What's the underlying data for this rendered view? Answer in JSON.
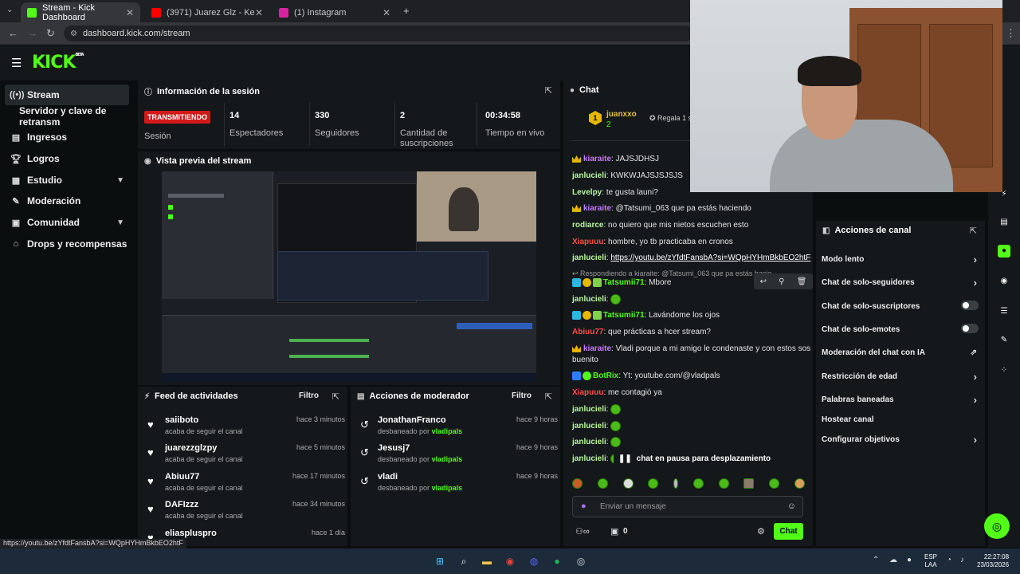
{
  "browser": {
    "tabs": [
      {
        "label": "Stream - Kick Dashboard",
        "active": true
      },
      {
        "label": "(3971) Juarez Glz - Kendo (Visu",
        "active": false
      },
      {
        "label": "(1) Instagram",
        "active": false
      }
    ],
    "url": "dashboard.kick.com/stream",
    "status_url": "https://youtu.be/zYfdtFansbA?si=WQpHYHmBkbEO2htF"
  },
  "brand": {
    "logo": "KICK",
    "beta": "BETA"
  },
  "sidebar": {
    "items": [
      {
        "label": "Stream",
        "icon": "broadcast-icon"
      },
      {
        "label": "Servidor y clave de retransm",
        "icon": ""
      },
      {
        "label": "Ingresos",
        "icon": "chart-icon"
      },
      {
        "label": "Logros",
        "icon": "trophy-icon"
      },
      {
        "label": "Estudio",
        "icon": "studio-icon"
      },
      {
        "label": "Moderación",
        "icon": "wrench-icon"
      },
      {
        "label": "Comunidad",
        "icon": "community-icon"
      },
      {
        "label": "Drops y recompensas",
        "icon": "gift-icon"
      }
    ]
  },
  "session": {
    "title": "Información de la sesión",
    "live_badge": "TRANSMITIENDO",
    "live_label": "Sesión",
    "stats": [
      {
        "value": "14",
        "label": "Espectadores"
      },
      {
        "value": "330",
        "label": "Seguidores"
      },
      {
        "value": "2",
        "label": "Cantidad de suscripciones"
      },
      {
        "value": "00:34:58",
        "label": "Tiempo en vivo"
      }
    ]
  },
  "preview": {
    "title": "Vista previa del stream"
  },
  "activity": {
    "title": "Feed de actividades",
    "filter": "Filtro",
    "items": [
      {
        "name": "saiiboto",
        "sub": "acaba de seguir el canal",
        "time": "hace 3 minutos"
      },
      {
        "name": "juarezzglzpy",
        "sub": "acaba de seguir el canal",
        "time": "hace 5 minutos"
      },
      {
        "name": "Abiuu77",
        "sub": "acaba de seguir el canal",
        "time": "hace 17 minutos"
      },
      {
        "name": "DAFIzzz",
        "sub": "acaba de seguir el canal",
        "time": "hace 34 minutos"
      },
      {
        "name": "eliaspluspro",
        "sub": "",
        "time": "hace 1 día"
      }
    ]
  },
  "modactions": {
    "title": "Acciones de moderador",
    "filter": "Filtro",
    "prefix": "desbaneado por",
    "items": [
      {
        "name": "JonathanFranco",
        "by": "vladipals",
        "time": "hace 9 horas"
      },
      {
        "name": "Jesusj7",
        "by": "vladipals",
        "time": "hace 9 horas"
      },
      {
        "name": "vladi",
        "by": "vladipals",
        "time": "hace 9 horas"
      }
    ]
  },
  "chat": {
    "title": "Chat",
    "pinned": {
      "rank": "1",
      "user": "juanxxo",
      "count": "2",
      "gift": "Regala 1 sus"
    },
    "reply_to": "Respondiendo a kiaraite: @Tatsumi_063 que pa estás hacie",
    "messages": [
      {
        "user": "kiaraite",
        "text": "JAJSJDHSJ",
        "color": "#c57bff"
      },
      {
        "user": "janlucieli",
        "text": "KWKWJAJSJSJSJS",
        "color": "#b9f6a0"
      },
      {
        "user": "Levelpy",
        "text": "te gusta launi?",
        "color": "#b9f6a0"
      },
      {
        "user": "kiaraite",
        "text": "@Tatsumi_063 que pa estás haciendo",
        "color": "#c57bff"
      },
      {
        "user": "rodiarce",
        "text": "no quiero que mis nietos escuchen esto",
        "color": "#b9f6a0"
      },
      {
        "user": "Xiapuuu",
        "text": "hombre, yo tb practicaba en cronos",
        "color": "#ff4d4d"
      },
      {
        "user": "janlucieli",
        "text": "https://youtu.be/zYfdtFansbA?si=WQpHYHmBkbEO2htF",
        "color": "#b9f6a0"
      },
      {
        "user": "Tatsumii71",
        "text": "Mbore",
        "color": "#53fc18"
      },
      {
        "user": "janlucieli",
        "text": "",
        "color": "#b9f6a0"
      },
      {
        "user": "Tatsumii71",
        "text": "Lavándome los ojos",
        "color": "#53fc18"
      },
      {
        "user": "Abiuu77",
        "text": "que prácticas a hcer stream?",
        "color": "#ff4d4d"
      },
      {
        "user": "kiaraite",
        "text": "Vladi porque a mi amigo le condenaste y con estos sos",
        "color": "#c57bff"
      },
      {
        "user": "",
        "text": "buenito",
        "color": "#e4e4e4"
      },
      {
        "user": "BotRix",
        "text": "Yt: youtube.com/@vladpals",
        "color": "#53fc18"
      },
      {
        "user": "Xiapuuu",
        "text": "me contagió ya",
        "color": "#ff4d4d"
      },
      {
        "user": "janlucieli",
        "text": "",
        "color": "#b9f6a0"
      },
      {
        "user": "janlucieli",
        "text": "",
        "color": "#b9f6a0"
      },
      {
        "user": "janlucieli",
        "text": "",
        "color": "#b9f6a0"
      },
      {
        "user": "janlucieli",
        "text": "",
        "color": "#b9f6a0"
      }
    ],
    "paused": "chat en pausa para desplazamiento",
    "placeholder": "Enviar un mensaje",
    "points": "0",
    "send": "Chat"
  },
  "channel_actions": {
    "title": "Acciones de canal",
    "items": [
      {
        "label": "Modo lento",
        "control": "chevron"
      },
      {
        "label": "Chat de solo-seguidores",
        "control": "chevron"
      },
      {
        "label": "Chat de solo-suscriptores",
        "control": "toggle"
      },
      {
        "label": "Chat de solo-emotes",
        "control": "toggle"
      },
      {
        "label": "Moderación del chat con IA",
        "control": "external"
      },
      {
        "label": "Restricción de edad",
        "control": "chevron"
      },
      {
        "label": "Palabras baneadas",
        "control": "chevron"
      },
      {
        "label": "Hostear canal",
        "control": "none"
      },
      {
        "label": "Configurar objetivos",
        "control": "chevron"
      }
    ]
  },
  "taskbar": {
    "lang": "ESP",
    "layout": "LAA",
    "time": "22:27:08",
    "date": "23/03/2026"
  },
  "colors": {
    "accent": "#53fc18",
    "live": "#d21919",
    "panel": "#14181a"
  }
}
